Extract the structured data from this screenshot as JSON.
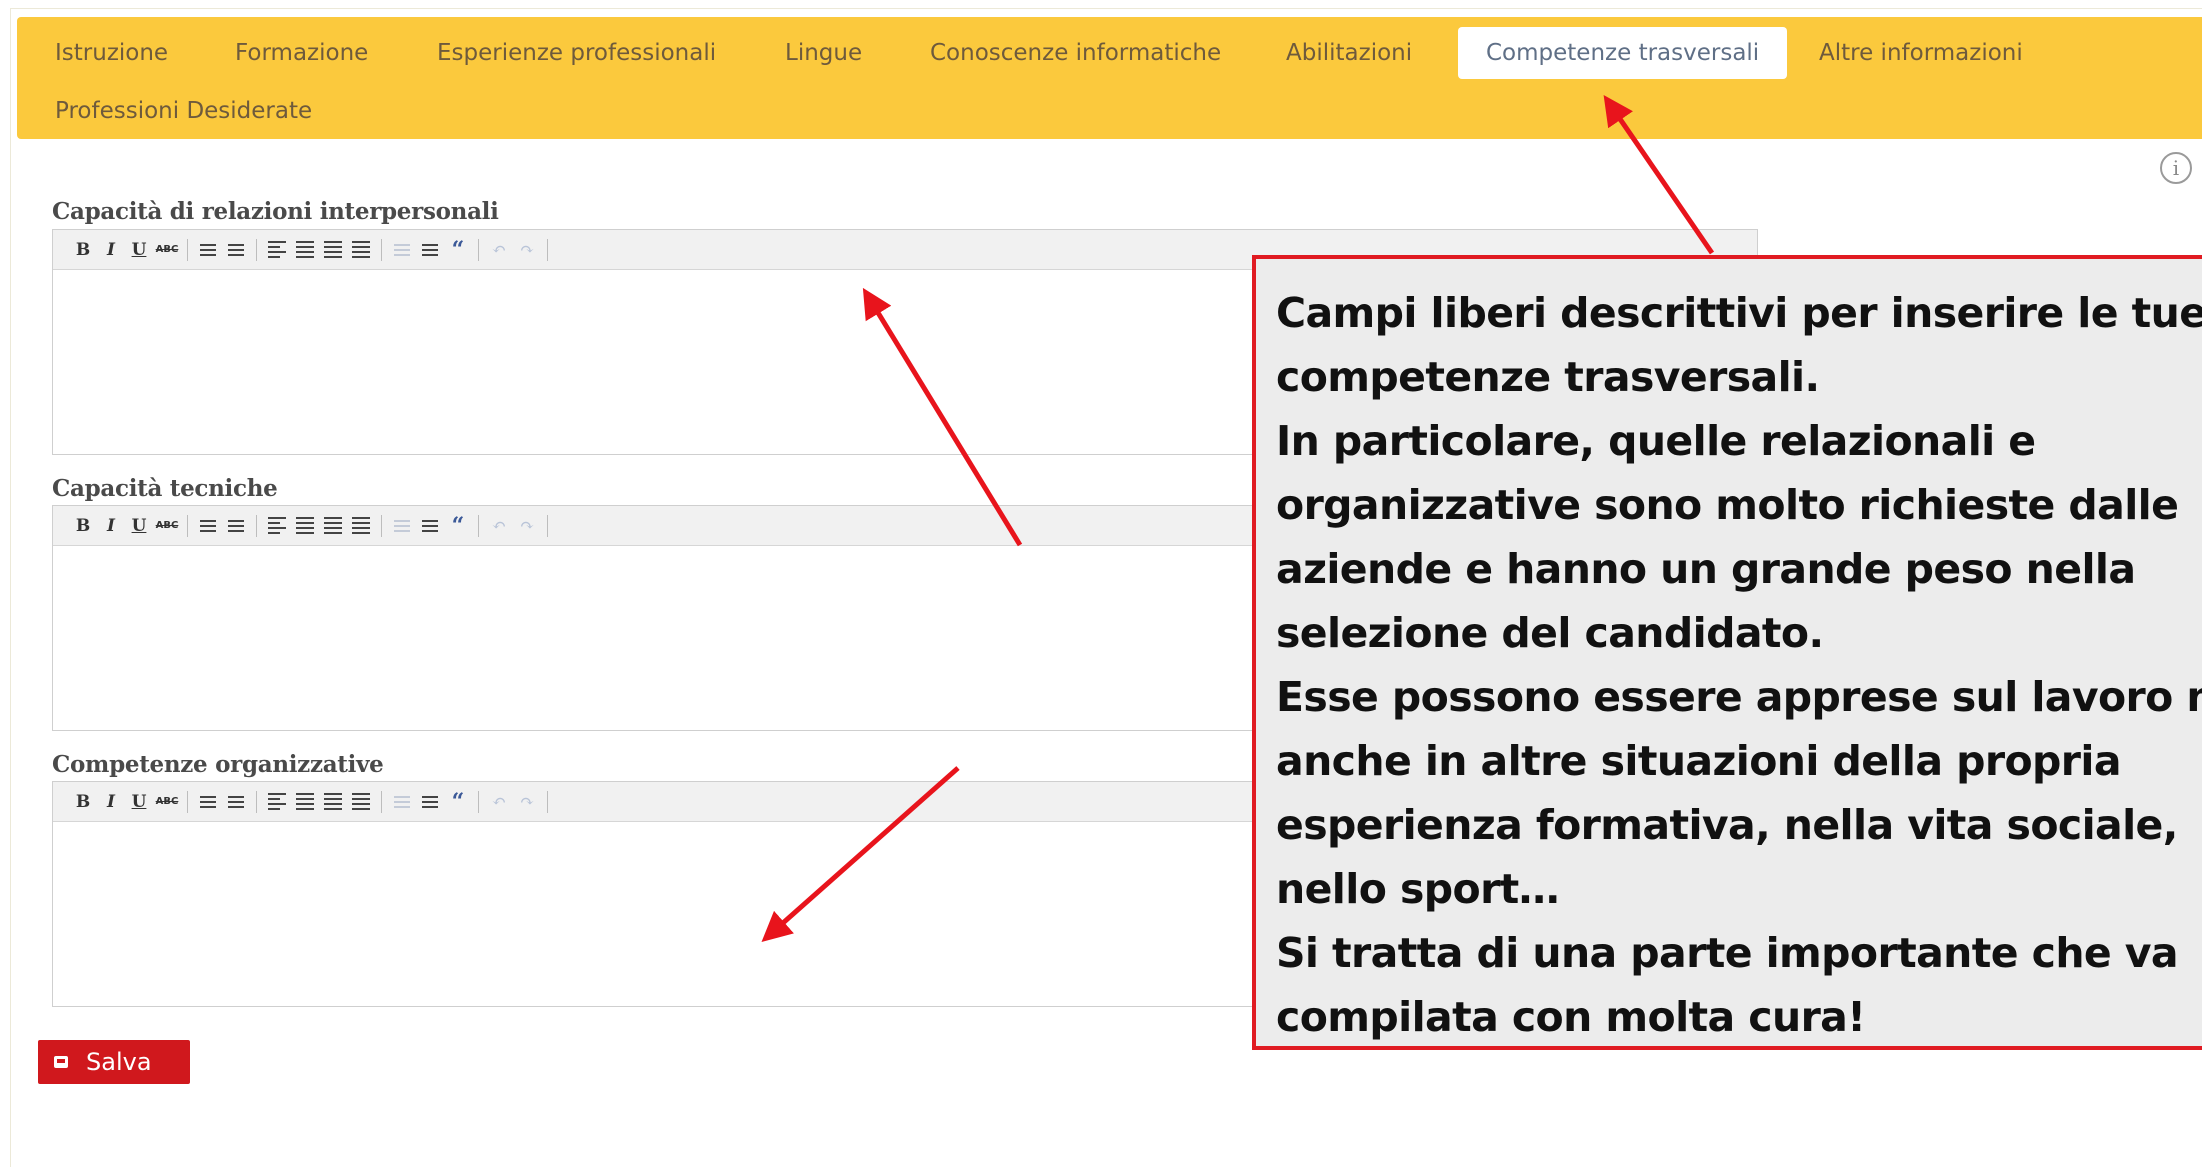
{
  "tabs": [
    {
      "label": "Istruzione",
      "active": false
    },
    {
      "label": "Formazione",
      "active": false
    },
    {
      "label": "Esperienze professionali",
      "active": false
    },
    {
      "label": "Lingue",
      "active": false
    },
    {
      "label": "Conoscenze informatiche",
      "active": false
    },
    {
      "label": "Abilitazioni",
      "active": false
    },
    {
      "label": "Competenze trasversali",
      "active": true
    },
    {
      "label": "Altre informazioni",
      "active": false
    },
    {
      "label": "Professioni Desiderate",
      "active": false
    }
  ],
  "info_icon": {
    "icon": "info-icon",
    "glyph": "i"
  },
  "fields": [
    {
      "label": "Capacità di relazioni interpersonali",
      "value": ""
    },
    {
      "label": "Capacità tecniche",
      "value": ""
    },
    {
      "label": "Competenze organizzative",
      "value": ""
    }
  ],
  "toolbar_buttons": [
    "B",
    "I",
    "U",
    "ABC",
    "“"
  ],
  "save_button": {
    "label": "Salva",
    "icon": "save-icon"
  },
  "callout": {
    "lines": [
      "Campi liberi descrittivi per inserire le tue",
      "competenze trasversali.",
      "In particolare, quelle relazionali e",
      "organizzative sono molto richieste dalle",
      "aziende e hanno un grande peso nella",
      "selezione del candidato.",
      "Esse possono essere apprese sul lavoro ma",
      "anche in altre situazioni della propria",
      "esperienza formativa, nella vita sociale,",
      "nello sport…",
      "Si tratta di una parte importante che va",
      "compilata con molta cura!"
    ]
  },
  "colors": {
    "tabbar": "#fbc93d",
    "save_button": "#d0181d",
    "callout_border": "#e01b22",
    "arrow": "#e8141c"
  }
}
